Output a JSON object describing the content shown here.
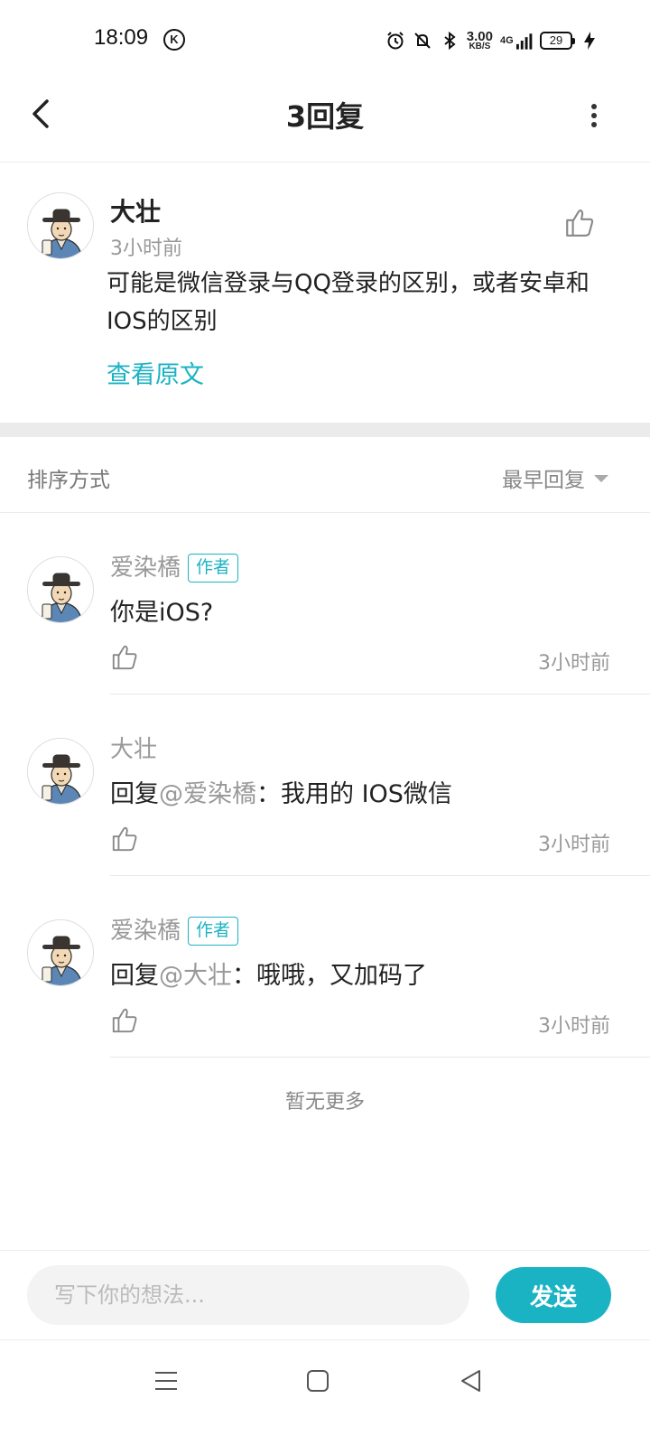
{
  "status_bar": {
    "time": "18:09",
    "k_badge": "K",
    "net_speed_value": "3.00",
    "net_speed_unit": "KB/S",
    "signal_label": "4G",
    "battery": "29"
  },
  "header": {
    "title": "3回复"
  },
  "main_comment": {
    "author": "大壮",
    "time": "3小时前",
    "text": "可能是微信登录与QQ登录的区别，或者安卓和IOS的区别",
    "view_original": "查看原文"
  },
  "sort": {
    "label": "排序方式",
    "selected": "最早回复"
  },
  "replies": [
    {
      "author": "爱染橋",
      "badge": "作者",
      "prefix": "",
      "mention": "",
      "text": "你是iOS?",
      "time": "3小时前"
    },
    {
      "author": "大壮",
      "badge": "",
      "prefix": "回复",
      "mention": "@爱染橋",
      "text": "：我用的 IOS微信",
      "time": "3小时前"
    },
    {
      "author": "爱染橋",
      "badge": "作者",
      "prefix": "回复",
      "mention": "@大壮",
      "text": "：哦哦，又加码了",
      "time": "3小时前"
    }
  ],
  "no_more": "暂无更多",
  "input": {
    "placeholder": "写下你的想法...",
    "send_label": "发送"
  },
  "colors": {
    "accent": "#1ab3c4",
    "muted_text": "#999999",
    "divider": "#ebebeb"
  },
  "icons": {
    "back": "chevron-left-icon",
    "more": "vertical-dots-icon",
    "like": "thumbs-up-icon",
    "nav_menu": "menu-icon",
    "nav_home": "square-icon",
    "nav_back": "triangle-back-icon"
  }
}
